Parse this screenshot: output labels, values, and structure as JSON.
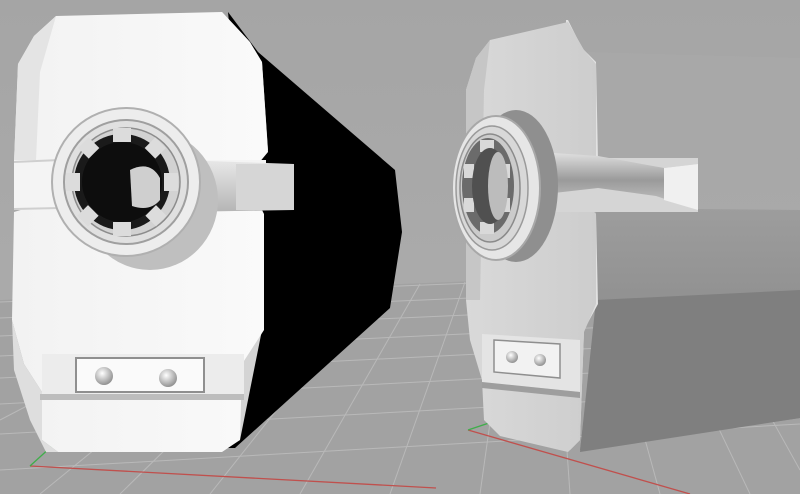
{
  "scene": {
    "description_free": true,
    "background_color": "#a9a9a9",
    "ground_color": "#a3a3a3",
    "grid_line_color": "#b8b8b8",
    "axis_x_color": "#c0504d",
    "axis_y_color": "#3fae4a",
    "objects": [
      {
        "id": "left",
        "shading": "flat-black-side",
        "spline_teeth": 8
      },
      {
        "id": "right",
        "shading": "smooth-gray",
        "spline_teeth": 6
      }
    ]
  }
}
